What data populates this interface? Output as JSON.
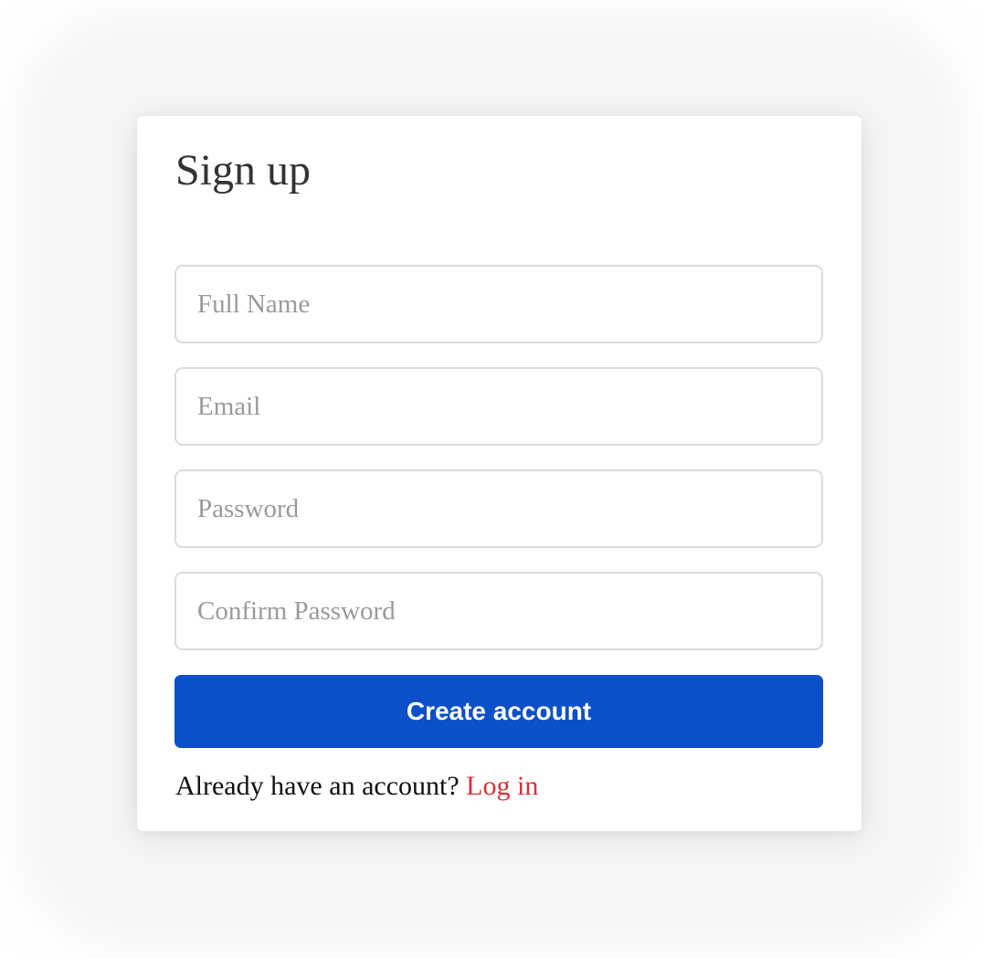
{
  "form": {
    "title": "Sign up",
    "fields": [
      {
        "placeholder": "Full Name",
        "value": ""
      },
      {
        "placeholder": "Email",
        "value": ""
      },
      {
        "placeholder": "Password",
        "value": ""
      },
      {
        "placeholder": "Confirm Password",
        "value": ""
      }
    ],
    "submit_label": "Create account",
    "footer_text": "Already have an account?",
    "login_link": "Log in"
  },
  "colors": {
    "primary": "#0b50c8",
    "link": "#d9303a",
    "placeholder": "#9a9a9a"
  }
}
